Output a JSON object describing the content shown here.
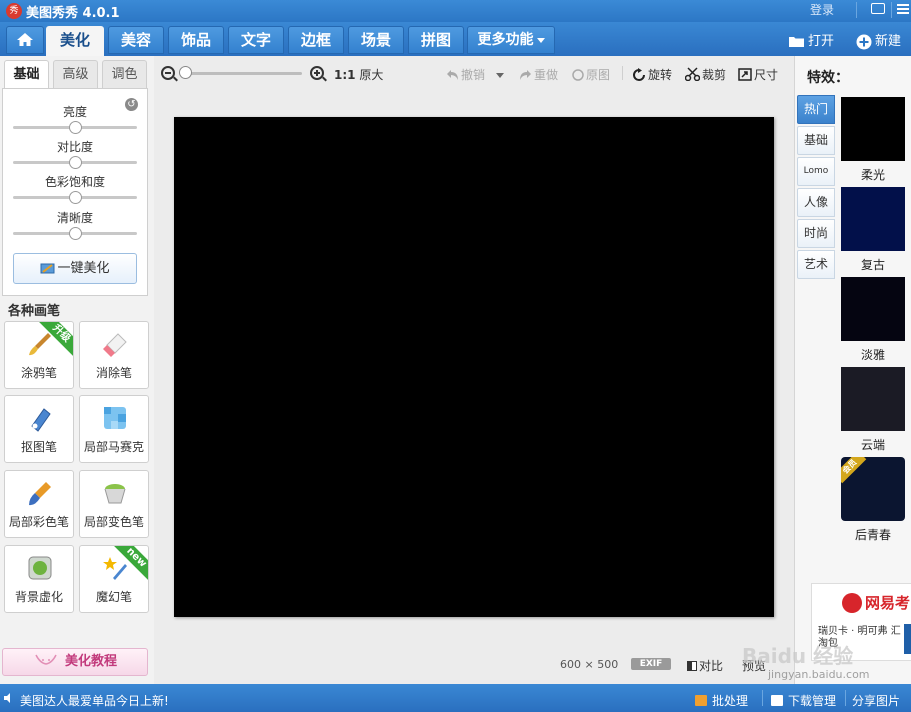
{
  "app": {
    "title": "美图秀秀 4.0.1",
    "icon_text": "秀",
    "login_label": "登录"
  },
  "tabs": [
    {
      "label": "美化"
    },
    {
      "label": "美容"
    },
    {
      "label": "饰品"
    },
    {
      "label": "文字"
    },
    {
      "label": "边框"
    },
    {
      "label": "场景"
    },
    {
      "label": "拼图"
    },
    {
      "label": "更多功能"
    }
  ],
  "toolbar": {
    "open_label": "打开",
    "new_label": "新建"
  },
  "left_panel": {
    "subtabs": [
      {
        "label": "基础"
      },
      {
        "label": "高级"
      },
      {
        "label": "调色"
      }
    ],
    "sliders": [
      {
        "label": "亮度",
        "level": 0.5
      },
      {
        "label": "对比度",
        "level": 0.5
      },
      {
        "label": "色彩饱和度",
        "level": 0.5
      },
      {
        "label": "清晰度",
        "level": 0.5
      }
    ],
    "one_key_label": "一键美化",
    "brush_section_title": "各种画笔",
    "tools": [
      {
        "label": "涂鸦笔",
        "ribbon": "升级"
      },
      {
        "label": "消除笔",
        "ribbon": ""
      },
      {
        "label": "抠图笔",
        "ribbon": ""
      },
      {
        "label": "局部马赛克",
        "ribbon": ""
      },
      {
        "label": "局部彩色笔",
        "ribbon": ""
      },
      {
        "label": "局部变色笔",
        "ribbon": ""
      },
      {
        "label": "背景虚化",
        "ribbon": ""
      },
      {
        "label": "魔幻笔",
        "ribbon": "new"
      }
    ],
    "tutorial_label": "美化教程"
  },
  "canvas_toolbar": {
    "zoom_level": 0,
    "ratio_label": "1:1",
    "original_size_label": "原大",
    "undo_label": "撤销",
    "redo_label": "重做",
    "original_image_label": "原图",
    "rotate_label": "旋转",
    "crop_label": "裁剪",
    "resize_label": "尺寸"
  },
  "canvas": {
    "width_text": "600",
    "times": "×",
    "height_text": "500",
    "exif_label": "EXIF",
    "compare_label": "对比",
    "preview_label": "预览"
  },
  "right_panel": {
    "title": "特效：",
    "categories": [
      {
        "label": "热门"
      },
      {
        "label": "基础"
      },
      {
        "label": "Lomo"
      },
      {
        "label": "人像"
      },
      {
        "label": "时尚"
      },
      {
        "label": "艺术"
      }
    ],
    "effects": [
      {
        "label": "柔光",
        "color": "#000000",
        "badge": ""
      },
      {
        "label": "复古",
        "color": "#02104a",
        "badge": ""
      },
      {
        "label": "淡雅",
        "color": "#050511",
        "badge": ""
      },
      {
        "label": "云端",
        "color": "#1b1b25",
        "badge": ""
      },
      {
        "label": "后青春",
        "color": "#0b1530",
        "badge": "会员"
      }
    ],
    "ad": {
      "title": "网易考",
      "text": "瑞贝卡 · 明可弗 汇淘包"
    }
  },
  "status": {
    "news": "美图达人最爱单品今日上新!",
    "batch_label": "批处理",
    "download_label": "下载管理",
    "share_label": "分享图片"
  },
  "watermark": {
    "text": "Baidu 经验",
    "url": "jingyan.baidu.com"
  },
  "colors": {
    "accent": "#2c77c5",
    "canvas_bg": "#000000",
    "active_tab_text": "#1a4f8c"
  }
}
